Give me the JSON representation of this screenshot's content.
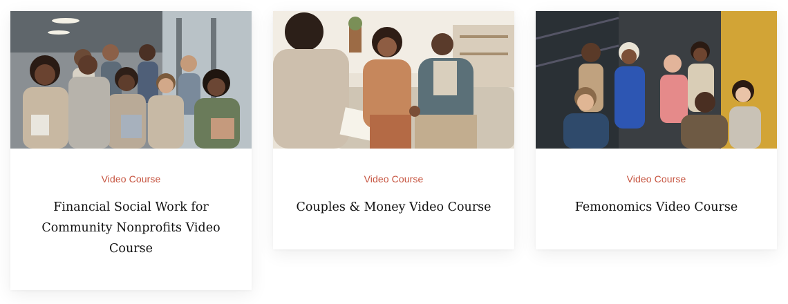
{
  "courses": [
    {
      "category": "Video Course",
      "title": "Financial Social Work for Community Nonprofits Video Course",
      "image_subject": "group of smiling professionals with lanyards and folders in an office"
    },
    {
      "category": "Video Course",
      "title": "Couples & Money Video Course",
      "image_subject": "counselor with notebook talking to a couple holding hands on a sofa"
    },
    {
      "category": "Video Course",
      "title": "Femonomics Video Course",
      "image_subject": "diverse group of people posing together in a modern space with yellow wall"
    }
  ],
  "colors": {
    "category_accent": "#c6533f",
    "title_text": "#111111"
  }
}
